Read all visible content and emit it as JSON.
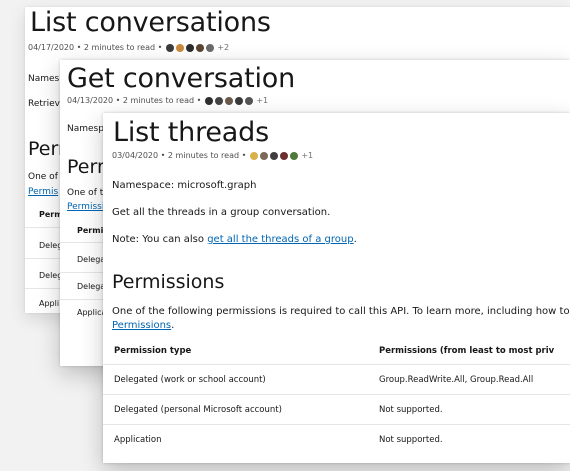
{
  "cards": {
    "list_conversations": {
      "title": "List conversations",
      "meta": "04/17/2020 • 2 minutes to read •",
      "more": "+2",
      "namespace_partial": "Names",
      "retrieve_partial": "Retriev",
      "perm_heading_partial": "Perr",
      "one_of_partial": "One of",
      "permis_partial": "Permis",
      "perm_partial": "Perm",
      "deleg1_partial": "Deleg",
      "deleg2_partial": "Deleg",
      "appli_partial": "Appli"
    },
    "get_conversation": {
      "title": "Get conversation",
      "meta": "04/13/2020 • 2 minutes to read •",
      "more": "+1",
      "namespace_partial": "Namesp",
      "perm_heading_partial": "Perm",
      "one_of_partial": "One of t",
      "permis_partial": "Permissi",
      "permis_type_partial": "Permis",
      "delega1_partial": "Delega",
      "delega2_partial": "Delega",
      "applica_partial": "Applica"
    },
    "list_threads": {
      "title": "List threads",
      "meta": "03/04/2020 • 2 minutes to read •",
      "more": "+1",
      "namespace": "Namespace: microsoft.graph",
      "description": "Get all the threads in a group conversation.",
      "note_prefix": "Note: You can also ",
      "note_link": "get all the threads of a group",
      "note_suffix": ".",
      "permissions_heading": "Permissions",
      "permissions_intro": "One of the following permissions is required to call this API. To learn more, including how to ch",
      "permissions_link": "Permissions",
      "permissions_link_suffix": ".",
      "table": {
        "headers": [
          "Permission type",
          "Permissions (from least to most priv"
        ],
        "rows": [
          [
            "Delegated (work or school account)",
            "Group.ReadWrite.All, Group.Read.All"
          ],
          [
            "Delegated (personal Microsoft account)",
            "Not supported."
          ],
          [
            "Application",
            "Not supported."
          ]
        ]
      }
    }
  },
  "avatar_colors": {
    "card1": [
      "#3b3b3b",
      "#c98a3c",
      "#2d2d2d",
      "#5a4630",
      "#6b6b6b"
    ],
    "card2": [
      "#2f2f2f",
      "#444444",
      "#6a5a4a",
      "#3a3a3a",
      "#555555"
    ],
    "card3": [
      "#d9b04a",
      "#7a6a5a",
      "#3f3f3f",
      "#6b2f2f",
      "#4f7a3a"
    ]
  }
}
